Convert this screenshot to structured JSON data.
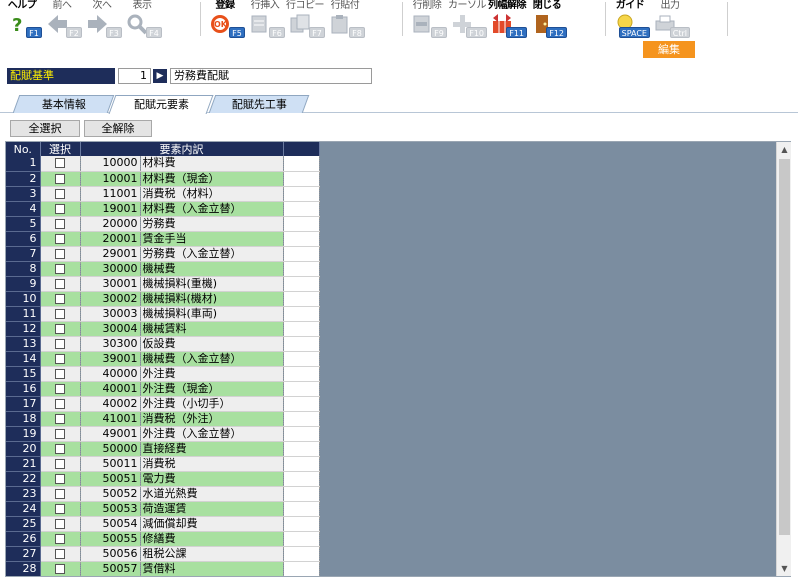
{
  "toolbar": {
    "buttons": [
      {
        "label": "ヘルプ",
        "key": "F1",
        "icon": "help-icon",
        "active": true
      },
      {
        "label": "前へ",
        "key": "F2",
        "icon": "arrow-left-icon",
        "active": false
      },
      {
        "label": "次へ",
        "key": "F3",
        "icon": "arrow-right-icon",
        "active": false
      },
      {
        "label": "表示",
        "key": "F4",
        "icon": "magnifier-icon",
        "active": false
      },
      {
        "label": "登録",
        "key": "F5",
        "icon": "ok-stamp-icon",
        "active": true
      },
      {
        "label": "行挿入",
        "key": "F6",
        "icon": "insert-row-icon",
        "active": false
      },
      {
        "label": "行コピー",
        "key": "F7",
        "icon": "copy-row-icon",
        "active": false
      },
      {
        "label": "行貼付",
        "key": "F8",
        "icon": "paste-row-icon",
        "active": false
      },
      {
        "label": "行削除",
        "key": "F9",
        "icon": "delete-row-icon",
        "active": false
      },
      {
        "label": "カーソル",
        "key": "F10",
        "icon": "cursor-cross-icon",
        "active": false
      },
      {
        "label": "列幅解除",
        "key": "F11",
        "icon": "column-width-icon",
        "active": true
      },
      {
        "label": "閉じる",
        "key": "F12",
        "icon": "door-icon",
        "active": true
      },
      {
        "label": "ガイド",
        "key": "SPACE",
        "icon": "lightbulb-icon",
        "active": true
      },
      {
        "label": "出力",
        "key": "Ctrl",
        "icon": "printer-icon",
        "active": false
      }
    ],
    "edit_badge": "編集"
  },
  "distribution": {
    "label": "配賦基準",
    "number": "1",
    "go": "▶",
    "name": "労務費配賦"
  },
  "tabs": [
    {
      "label": "基本情報",
      "active": false
    },
    {
      "label": "配賦元要素",
      "active": true
    },
    {
      "label": "配賦先工事",
      "active": false
    }
  ],
  "actions": {
    "select_all": "全選択",
    "clear_all": "全解除"
  },
  "grid": {
    "headers": {
      "no": "No.",
      "select": "選択",
      "element": "要素内訳"
    },
    "rows": [
      {
        "no": "1",
        "code": "10000",
        "name": "材料費"
      },
      {
        "no": "2",
        "code": "10001",
        "name": "材料費（現金）"
      },
      {
        "no": "3",
        "code": "11001",
        "name": "消費税（材料）"
      },
      {
        "no": "4",
        "code": "19001",
        "name": "材料費（入金立替）"
      },
      {
        "no": "5",
        "code": "20000",
        "name": "労務費"
      },
      {
        "no": "6",
        "code": "20001",
        "name": "賃金手当"
      },
      {
        "no": "7",
        "code": "29001",
        "name": "労務費（入金立替）"
      },
      {
        "no": "8",
        "code": "30000",
        "name": "機械費"
      },
      {
        "no": "9",
        "code": "30001",
        "name": "機械損料(重機)"
      },
      {
        "no": "10",
        "code": "30002",
        "name": "機械損料(機材)"
      },
      {
        "no": "11",
        "code": "30003",
        "name": "機械損料(車両)"
      },
      {
        "no": "12",
        "code": "30004",
        "name": "機械賃料"
      },
      {
        "no": "13",
        "code": "30300",
        "name": "仮設費"
      },
      {
        "no": "14",
        "code": "39001",
        "name": "機械費（入金立替）"
      },
      {
        "no": "15",
        "code": "40000",
        "name": "外注費"
      },
      {
        "no": "16",
        "code": "40001",
        "name": "外注費（現金）"
      },
      {
        "no": "17",
        "code": "40002",
        "name": "外注費（小切手）"
      },
      {
        "no": "18",
        "code": "41001",
        "name": "消費税（外注）"
      },
      {
        "no": "19",
        "code": "49001",
        "name": "外注費（入金立替）"
      },
      {
        "no": "20",
        "code": "50000",
        "name": "直接経費"
      },
      {
        "no": "21",
        "code": "50011",
        "name": "消費税"
      },
      {
        "no": "22",
        "code": "50051",
        "name": "電力費"
      },
      {
        "no": "23",
        "code": "50052",
        "name": "水道光熱費"
      },
      {
        "no": "24",
        "code": "50053",
        "name": "荷造運賃"
      },
      {
        "no": "25",
        "code": "50054",
        "name": "減価償却費"
      },
      {
        "no": "26",
        "code": "50055",
        "name": "修繕費"
      },
      {
        "no": "27",
        "code": "50056",
        "name": "租税公課"
      },
      {
        "no": "28",
        "code": "50057",
        "name": "賃借料"
      }
    ]
  },
  "colors": {
    "header_navy": "#1e2d5a",
    "row_green": "#a8e0a0",
    "row_gray": "#eeeeee",
    "grid_bg": "#7b8da0",
    "edit_orange": "#f5941e",
    "label_yellow": "#fff000"
  }
}
